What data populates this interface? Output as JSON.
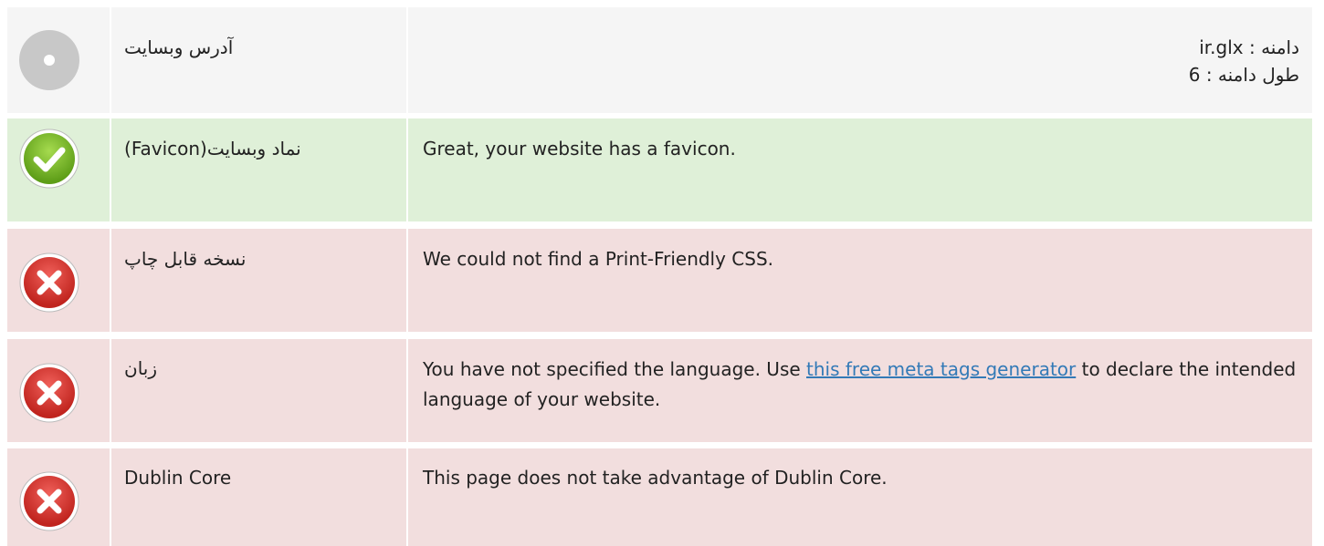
{
  "rows": [
    {
      "status": "info",
      "icon": "neutral-circle-icon",
      "label": "آدرس وبسایت",
      "lines": [
        "دامنه : ir.glx",
        "طول دامنه : 6"
      ]
    },
    {
      "status": "pass",
      "icon": "checkmark-icon",
      "label": "نماد وبسایت(Favicon)",
      "text": "Great, your website has a favicon."
    },
    {
      "status": "fail",
      "icon": "error-x-icon",
      "label": "نسخه قابل چاپ",
      "text": "We could not find a Print-Friendly CSS."
    },
    {
      "status": "fail",
      "icon": "error-x-icon",
      "label": "زبان",
      "text_before": "You have not specified the language. Use ",
      "link": "this free meta tags generator",
      "text_after": " to declare the intended language of your website."
    },
    {
      "status": "fail",
      "icon": "error-x-icon",
      "label": "Dublin Core",
      "text": "This page does not take advantage of Dublin Core."
    }
  ],
  "colors": {
    "info_bg": "#f5f5f5",
    "pass_bg": "#dff0d8",
    "fail_bg": "#f2dede",
    "link": "#337ab7",
    "neutral_icon": "#c8c8c8",
    "pass_icon": "#7cbf2d",
    "fail_icon": "#d9342b"
  }
}
